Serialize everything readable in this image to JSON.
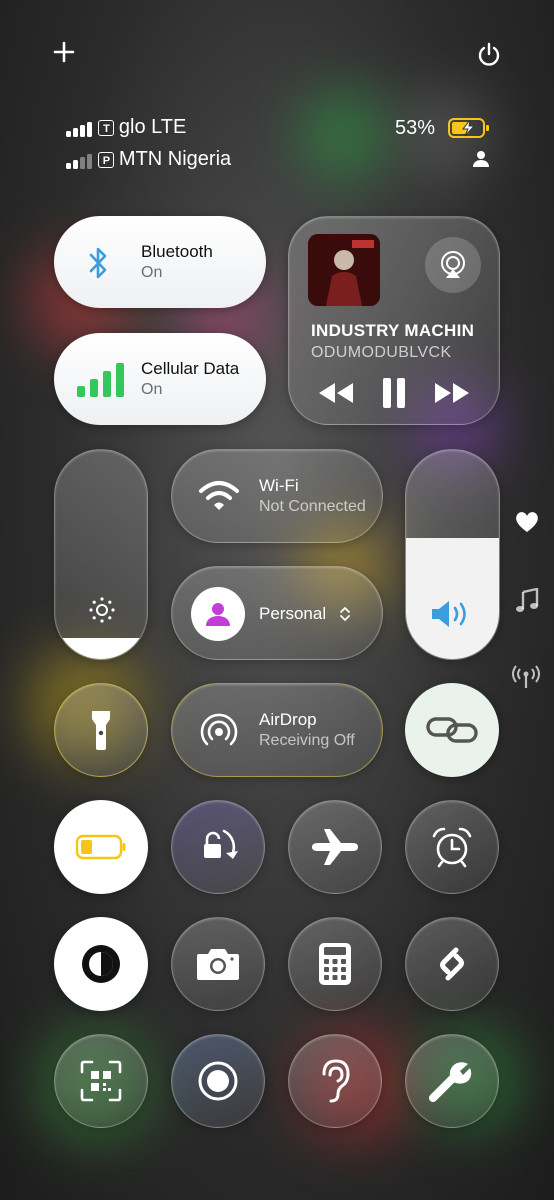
{
  "status": {
    "sim1": {
      "badge": "T",
      "carrier": "glo LTE"
    },
    "sim2": {
      "badge": "P",
      "carrier": "MTN Nigeria"
    },
    "battery": "53%"
  },
  "connectivity": {
    "bluetooth": {
      "title": "Bluetooth",
      "state": "On"
    },
    "cellular": {
      "title": "Cellular Data",
      "state": "On"
    },
    "wifi": {
      "title": "Wi-Fi",
      "state": "Not Connected"
    },
    "airdrop": {
      "title": "AirDrop",
      "state": "Receiving Off"
    }
  },
  "now_playing": {
    "title": "INDUSTRY MACHIN",
    "artist": "ODUMODUBLVCK"
  },
  "focus": {
    "label": "Personal"
  },
  "levels": {
    "brightness": 0.1,
    "volume": 0.58
  },
  "colors": {
    "accent_blue": "#3a9dde",
    "cellular_green": "#34c759",
    "focus_purple": "#c13fd4",
    "battery_yellow": "#f5c518"
  }
}
